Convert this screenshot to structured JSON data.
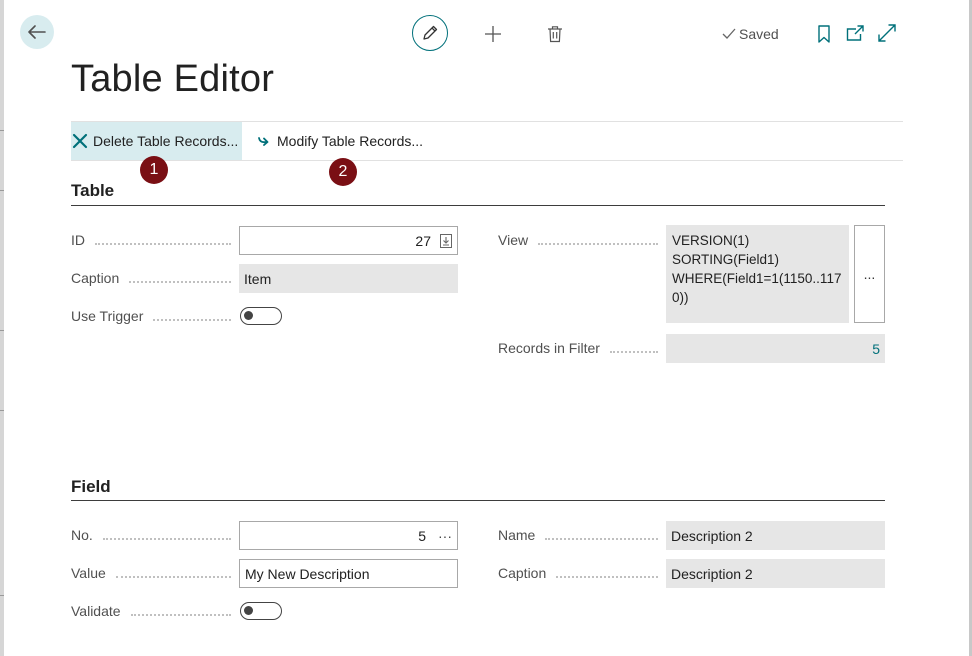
{
  "topbar": {
    "saved_label": "Saved",
    "icons": [
      "back-arrow-icon",
      "pencil-icon",
      "plus-icon",
      "trash-icon",
      "checkmark-icon",
      "bookmark-icon",
      "share-icon",
      "expand-icon"
    ]
  },
  "page": {
    "title": "Table Editor"
  },
  "actions": {
    "delete_label": "Delete Table Records...",
    "modify_label": "Modify Table Records...",
    "badge_1": "1",
    "badge_2": "2"
  },
  "table_section": {
    "title": "Table",
    "id_label": "ID",
    "id_value": "27",
    "caption_label": "Caption",
    "caption_value": "Item",
    "use_trigger_label": "Use Trigger",
    "use_trigger_value": false,
    "view_label": "View",
    "view_lines": [
      "VERSION(1)",
      "SORTING(Field1)",
      "WHERE(Field1=1(1150..1170))"
    ],
    "view_assist_label": "...",
    "records_label": "Records in Filter",
    "records_value": "5"
  },
  "field_section": {
    "title": "Field",
    "no_label": "No.",
    "no_value": "5",
    "no_assist": "···",
    "value_label": "Value",
    "value_value": "My New Description",
    "validate_label": "Validate",
    "validate_value": false,
    "name_label": "Name",
    "name_value": "Description 2",
    "caption_label": "Caption",
    "caption_value": "Description 2"
  },
  "colors": {
    "accent": "#00707a",
    "badge": "#7a0f14",
    "action_highlight": "#d8ecef",
    "readonly_bg": "#e6e6e6"
  }
}
